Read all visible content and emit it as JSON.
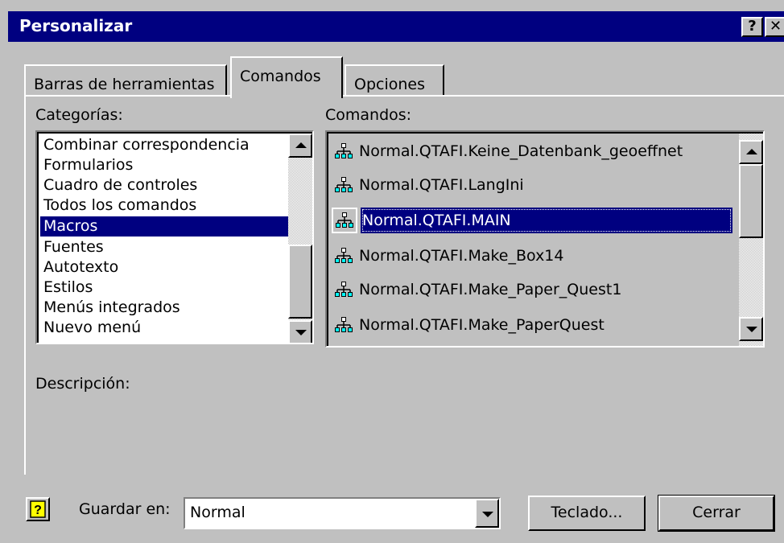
{
  "window": {
    "title": "Personalizar",
    "help_glyph": "?",
    "close_glyph": "✕"
  },
  "tabs": [
    {
      "label": "Barras de herramientas",
      "accel": "B",
      "active": false
    },
    {
      "label": "Comandos",
      "accel": "C",
      "active": true
    },
    {
      "label": "Opciones",
      "accel": "O",
      "active": false
    }
  ],
  "categories": {
    "label": "Categorías:",
    "items": [
      "Combinar correspondencia",
      "Formularios",
      "Cuadro de controles",
      "Todos los comandos",
      "Macros",
      "Fuentes",
      "Autotexto",
      "Estilos",
      "Menús integrados",
      "Nuevo menú"
    ],
    "selected": "Macros"
  },
  "commands": {
    "label": "Comandos:",
    "icon": "macro-icon",
    "items": [
      "Normal.QTAFI.Keine_Datenbank_geoeffnet",
      "Normal.QTAFI.LangIni",
      "Normal.QTAFI.MAIN",
      "Normal.QTAFI.Make_Box14",
      "Normal.QTAFI.Make_Paper_Quest1",
      "Normal.QTAFI.Make_PaperQuest"
    ],
    "selected": "Normal.QTAFI.MAIN"
  },
  "description": {
    "label": "Descripción:"
  },
  "footer": {
    "help_icon": "help-book-icon",
    "save_in_label": "Guardar en:",
    "save_in_value": "Normal",
    "keyboard_button": "Teclado...",
    "close_button": "Cerrar"
  },
  "colors": {
    "titlebar": "#000080",
    "face": "#c0c0c0",
    "selection": "#000080"
  }
}
